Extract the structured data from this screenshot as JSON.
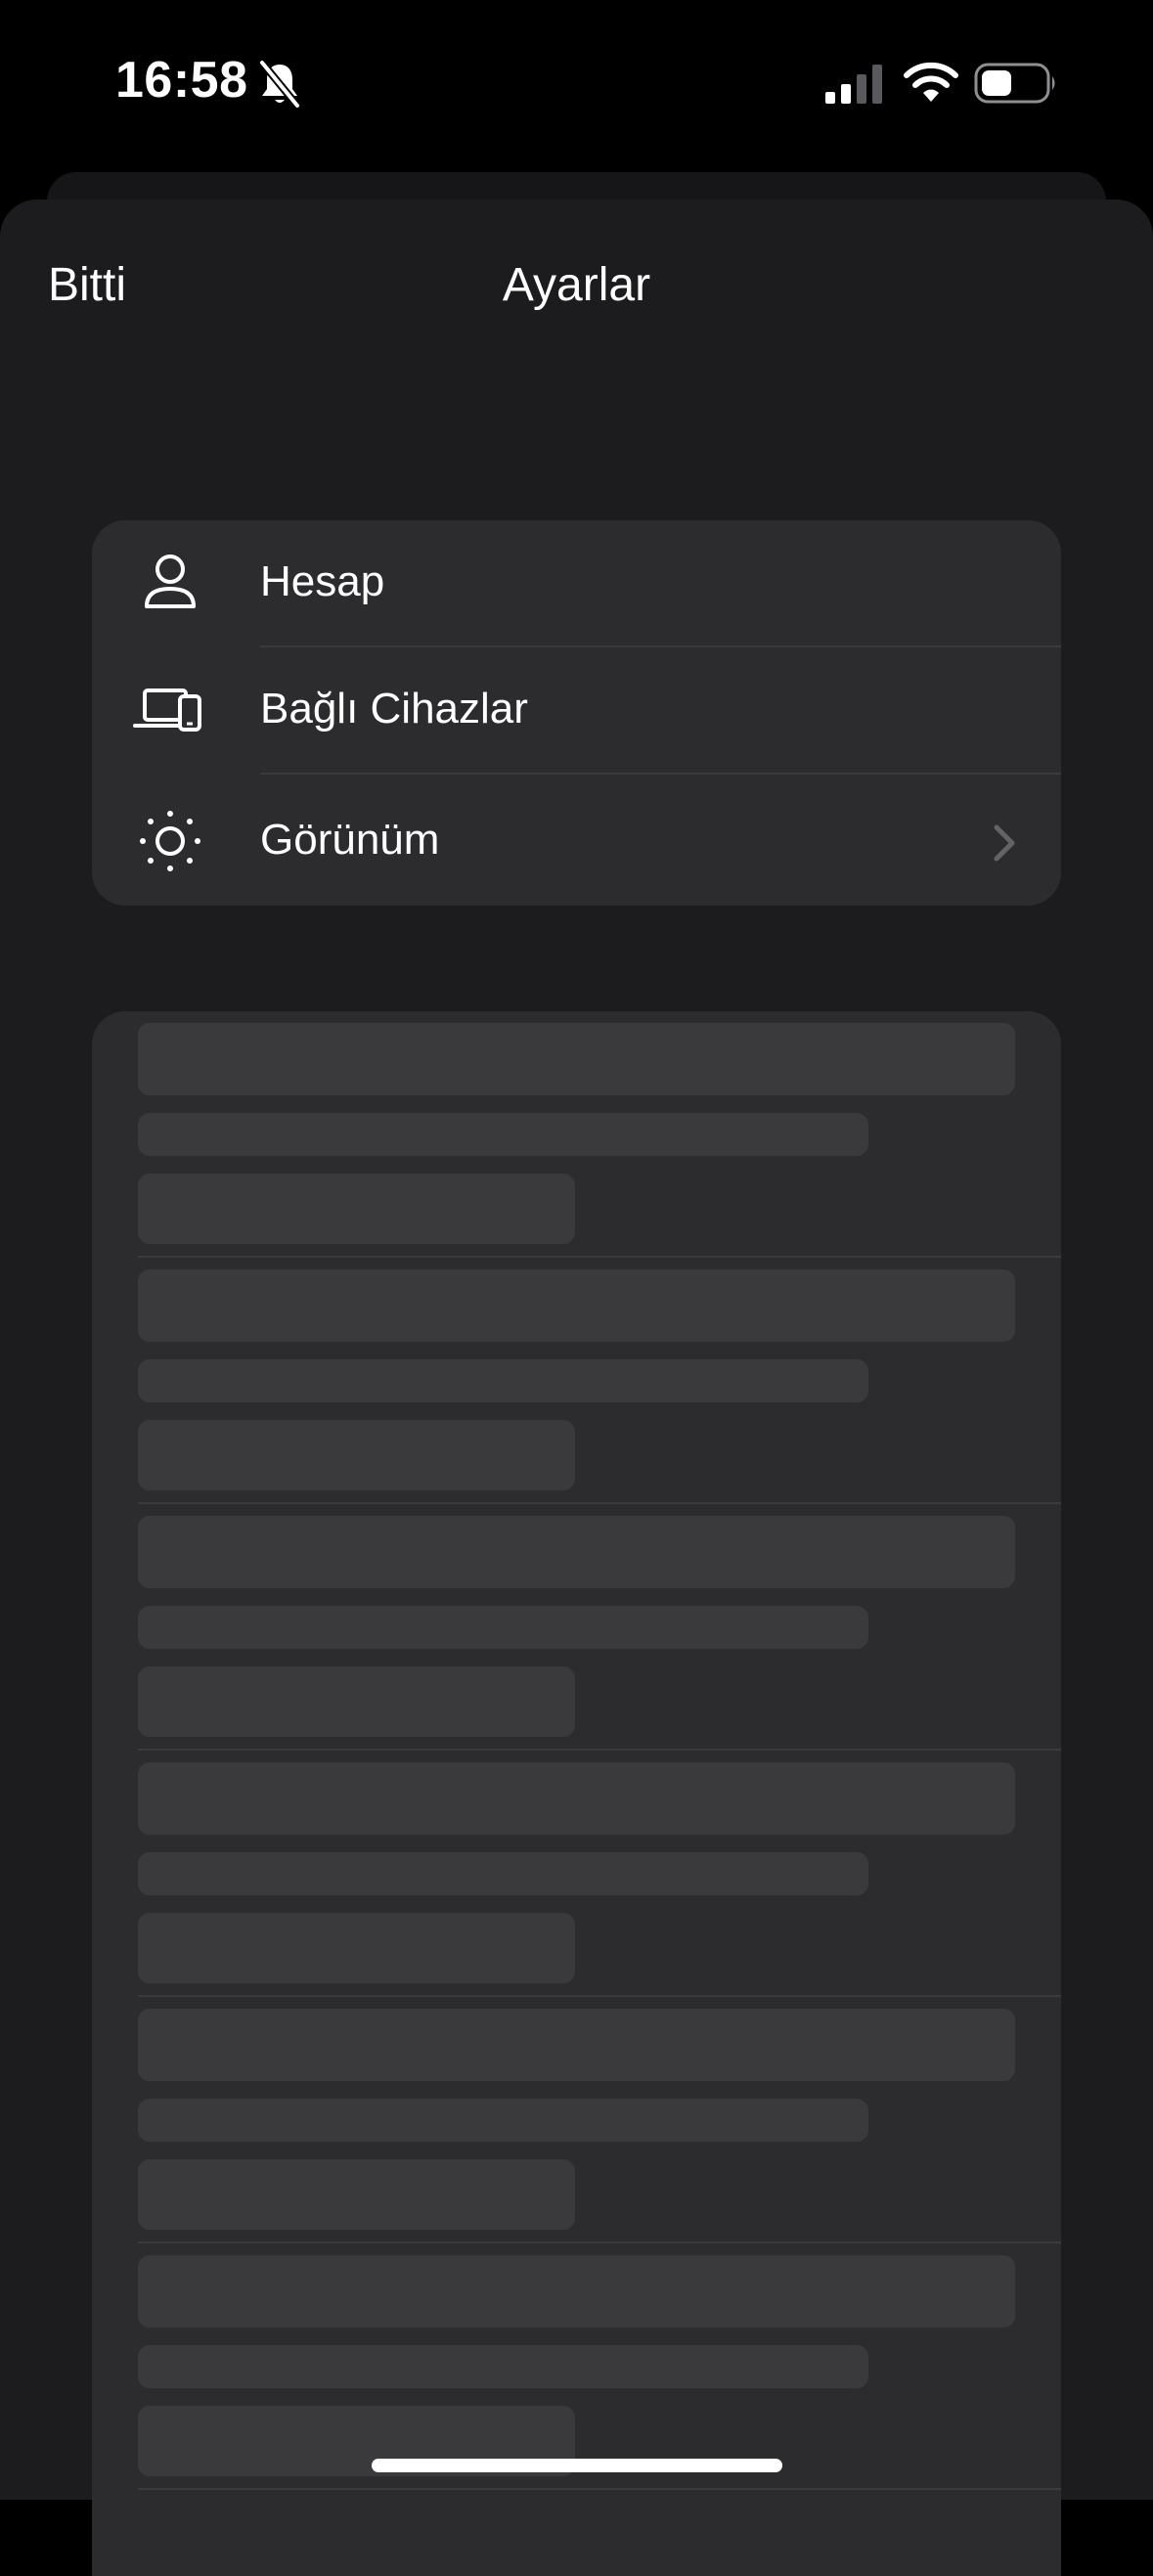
{
  "status_bar": {
    "time": "16:58",
    "icons": [
      "bell-slash-icon",
      "cellular-signal-icon",
      "wifi-icon",
      "battery-icon"
    ]
  },
  "nav": {
    "done_label": "Bitti",
    "title": "Ayarlar"
  },
  "settings": {
    "items": [
      {
        "label": "Hesap",
        "icon": "person-icon"
      },
      {
        "label": "Bağlı Cihazlar",
        "icon": "laptop-phone-icon"
      },
      {
        "label": "Görünüm",
        "icon": "sun-icon",
        "has_chevron": true
      }
    ]
  },
  "skeleton": {
    "placeholder_rows": 6,
    "state": "loading"
  },
  "colors": {
    "background": "#000000",
    "sheet": "#1c1c1e",
    "group": "#2c2c2e",
    "skeleton": "#3a3a3c",
    "text": "#ffffff"
  }
}
